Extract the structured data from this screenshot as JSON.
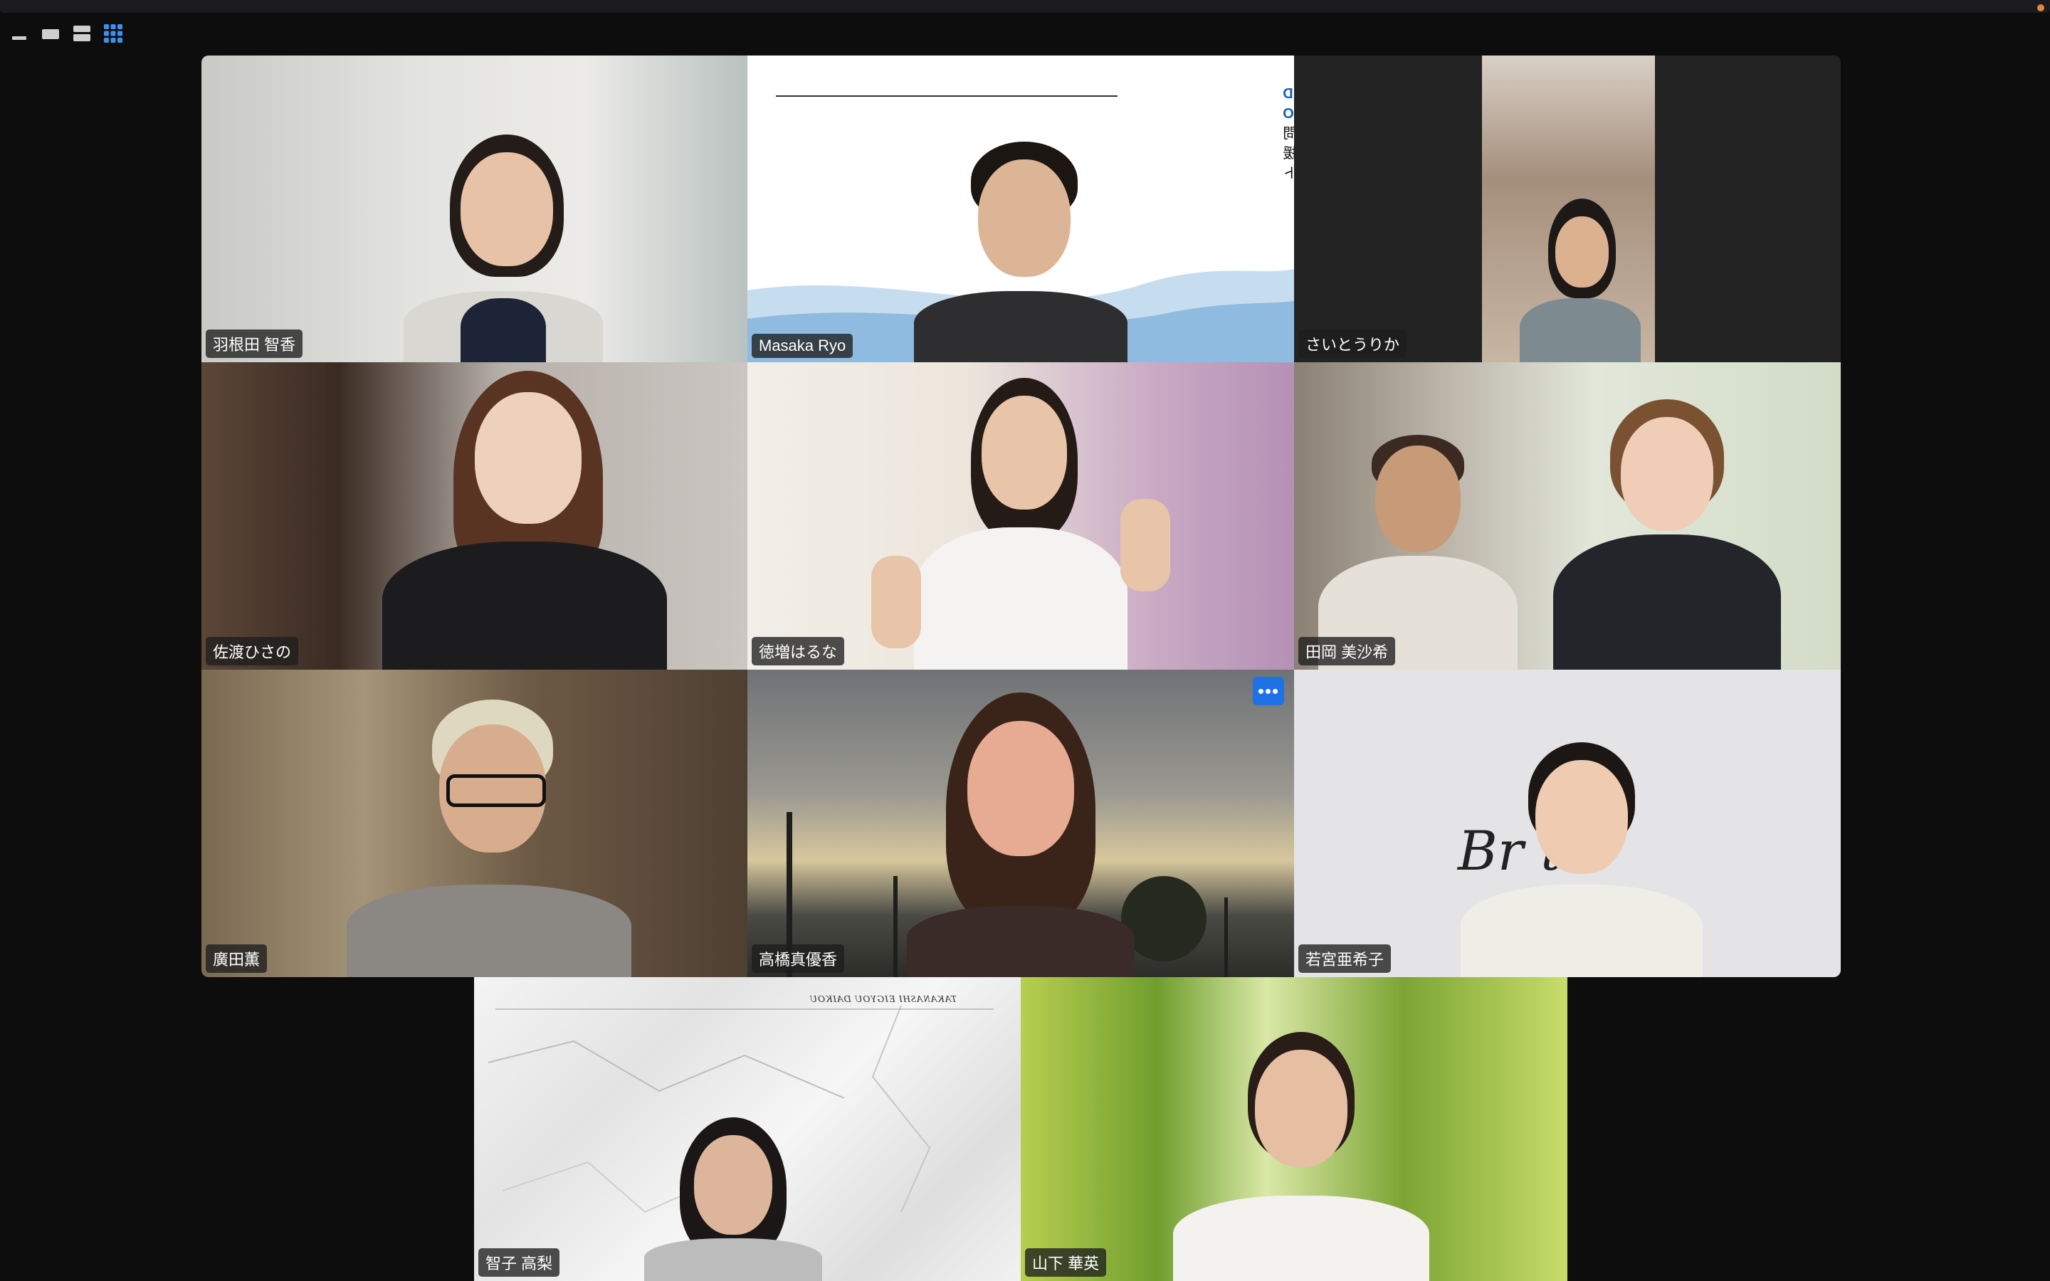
{
  "window": {
    "accent_dot_color": "#e08a3c"
  },
  "view_controls": [
    {
      "icon": "minimize-icon"
    },
    {
      "icon": "thumbnail-view-icon"
    },
    {
      "icon": "speaker-view-icon"
    },
    {
      "icon": "gallery-view-icon",
      "active": true
    }
  ],
  "participants": [
    {
      "name": "羽根田 智香"
    },
    {
      "name": "Masaka Ryo",
      "active_speaker": true
    },
    {
      "name": "さいとうりか"
    },
    {
      "name": "佐渡ひさの"
    },
    {
      "name": "徳増はるな"
    },
    {
      "name": "田岡 美沙希"
    },
    {
      "name": "廣田薫"
    },
    {
      "name": "高橋真優香",
      "more_button": "•••"
    },
    {
      "name": "若宮亜希子"
    },
    {
      "name": "智子 高梨"
    },
    {
      "name": "山下 華英"
    }
  ],
  "slide": {
    "company": "RE PLUS ASIA SDN.BHD",
    "role": "CEO",
    "line1": "集客・求人顧問",
    "line2": "FC支援",
    "line3": "マレーシア留学サポート"
  },
  "marble_caption": "TAKANASHI EIGYOU DAIKOU",
  "backdrop_script": "Br        t",
  "colors": {
    "active_outline": "#35c43a",
    "more_button": "#1f72e6"
  }
}
